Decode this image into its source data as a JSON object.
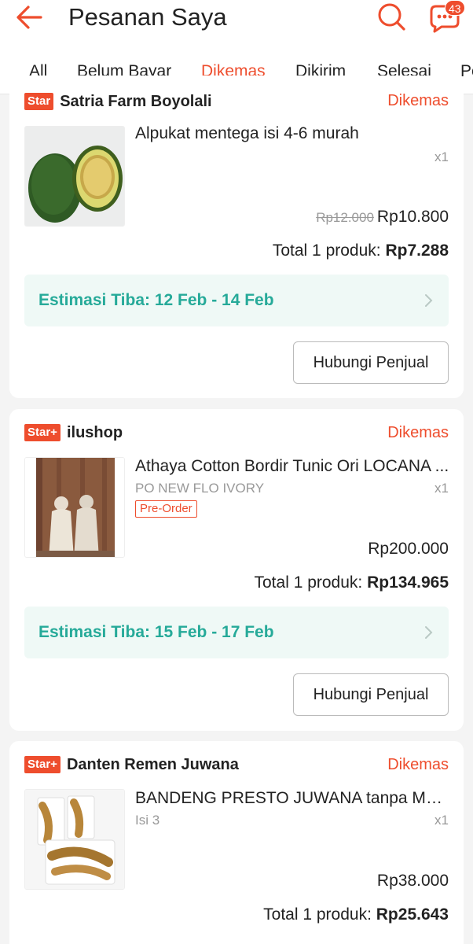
{
  "header": {
    "title": "Pesanan Saya",
    "back_icon": "arrow-left-icon",
    "search_icon": "search-icon",
    "chat_icon": "chat-icon",
    "chat_badge": "43",
    "accent": "#ee4d2d"
  },
  "tabs": [
    {
      "label": "All"
    },
    {
      "label": "Belum Bayar"
    },
    {
      "label": "Dikemas",
      "active": true
    },
    {
      "label": "Dikirim"
    },
    {
      "label": "Selesai"
    },
    {
      "label": "Pe"
    }
  ],
  "orders": [
    {
      "badge": "Star",
      "shop": "Satria Farm Boyolali",
      "status": "Dikemas",
      "product": "Alpukat mentega isi 4-6 murah",
      "variant": "",
      "qty": "x1",
      "price_old": "Rp12.000",
      "price": "Rp10.800",
      "total_label": "Total 1 produk: ",
      "total_value": "Rp7.288",
      "eta": "Estimasi Tiba: 12 Feb - 14 Feb",
      "contact": "Hubungi Penjual"
    },
    {
      "badge": "Star+",
      "shop": "ilushop",
      "status": "Dikemas",
      "product": "Athaya Cotton Bordir Tunic Ori LOCANA ...",
      "variant": "PO NEW FLO IVORY",
      "tag": "Pre-Order",
      "qty": "x1",
      "price": "Rp200.000",
      "total_label": "Total 1 produk: ",
      "total_value": "Rp134.965",
      "eta": "Estimasi Tiba: 15 Feb - 17 Feb",
      "contact": "Hubungi Penjual"
    },
    {
      "badge": "Star+",
      "shop": "Danten Remen Juwana",
      "status": "Dikemas",
      "product": "BANDENG PRESTO JUWANA tanpa MS...",
      "variant": "Isi 3",
      "qty": "x1",
      "price": "Rp38.000",
      "total_label": "Total 1 produk: ",
      "total_value": "Rp25.643"
    }
  ],
  "colors": {
    "eta_text": "#26aa99",
    "eta_bg": "#eff9f6",
    "background": "#f4f4f4"
  }
}
